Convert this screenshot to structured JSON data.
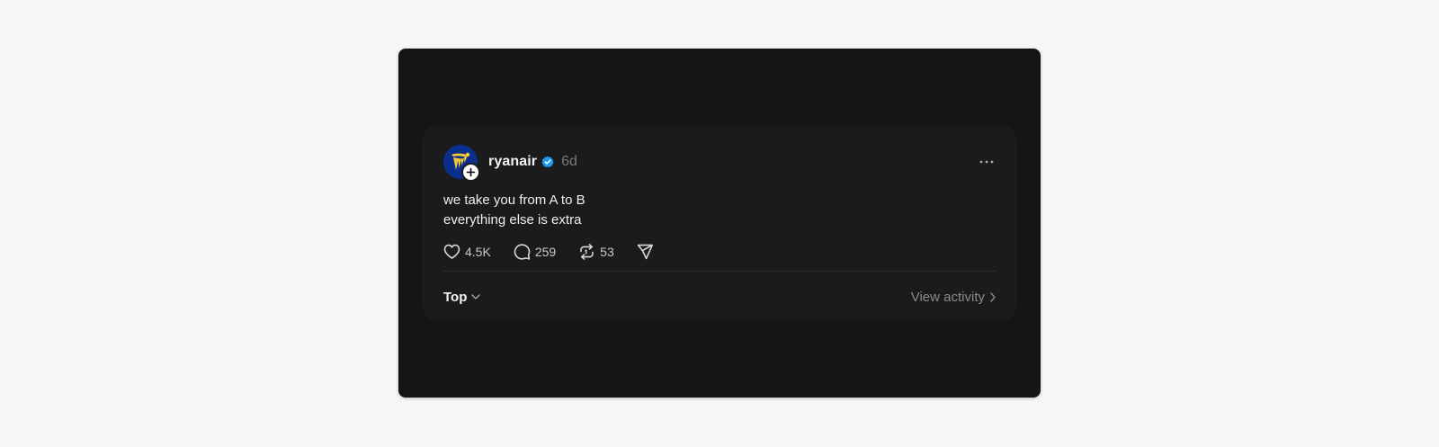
{
  "post": {
    "author": {
      "username": "ryanair",
      "verified": true,
      "avatar_icon": "ryanair-harp-logo",
      "follow_icon": "plus-icon"
    },
    "time_ago": "6d",
    "text_lines": [
      "we take you from A to B",
      "everything else is extra"
    ],
    "actions": {
      "like": {
        "icon": "heart-icon",
        "count": "4.5K"
      },
      "reply": {
        "icon": "comment-icon",
        "count": "259"
      },
      "repost": {
        "icon": "repost-icon",
        "count": "53"
      },
      "share": {
        "icon": "send-icon"
      }
    }
  },
  "footer": {
    "sort_label": "Top",
    "activity_label": "View activity"
  },
  "colors": {
    "page_background": "#f5f6f8",
    "frame_background": "#151515",
    "card_background": "#1b1b1b",
    "verified_blue": "#1d9bf0",
    "avatar_blue": "#0b2d8c",
    "logo_yellow": "#f1c933"
  }
}
